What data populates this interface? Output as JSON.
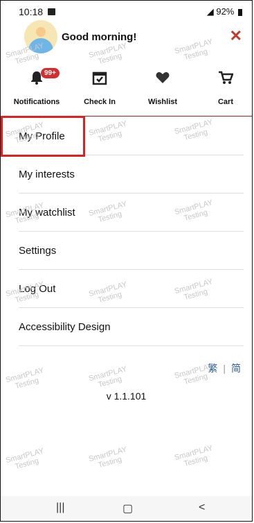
{
  "status": {
    "time": "10:18",
    "battery": "92%"
  },
  "header": {
    "greeting": "Good morning!",
    "close_symbol": "✕"
  },
  "shortcuts": [
    {
      "label": "Notifications",
      "icon": "bell-icon",
      "badge": "99+"
    },
    {
      "label": "Check In",
      "icon": "calendar-check-icon"
    },
    {
      "label": "Wishlist",
      "icon": "heart-icon"
    },
    {
      "label": "Cart",
      "icon": "cart-icon"
    }
  ],
  "menu": [
    {
      "label": "My Profile"
    },
    {
      "label": "My interests"
    },
    {
      "label": "My watchlist"
    },
    {
      "label": "Settings"
    },
    {
      "label": "Log Out"
    },
    {
      "label": "Accessibility Design"
    }
  ],
  "language": {
    "traditional": "繁",
    "simplified": "简",
    "separator": "|"
  },
  "version": "v 1.1.101",
  "watermark": [
    "SmartPLAY",
    "Testing"
  ],
  "colors": {
    "accent": "#c0392b",
    "badge": "#d32f2f",
    "highlight": "#e02020",
    "lang": "#2a5d8f"
  }
}
